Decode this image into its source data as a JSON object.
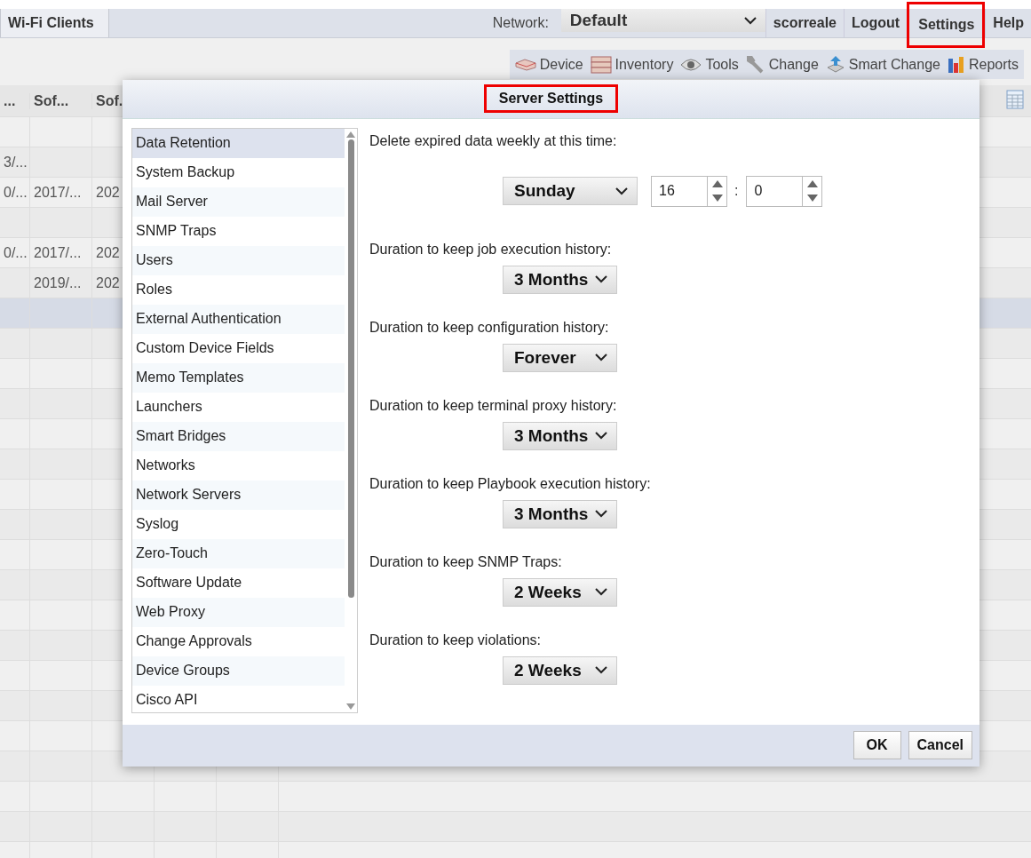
{
  "header": {
    "tabs": [
      {
        "label": "Wi-Fi Clients",
        "selected": true
      }
    ],
    "network": {
      "label": "Network:",
      "value": "Default"
    },
    "nav": [
      {
        "label": "scorreale",
        "highlighted": false
      },
      {
        "label": "Logout",
        "highlighted": false
      },
      {
        "label": "Settings",
        "highlighted": true
      },
      {
        "label": "Help",
        "highlighted": false
      }
    ]
  },
  "toolbar": [
    {
      "label": "Device",
      "kind": "device"
    },
    {
      "label": "Inventory",
      "kind": "inventory"
    },
    {
      "label": "Tools",
      "kind": "tools"
    },
    {
      "label": "Change",
      "kind": "change"
    },
    {
      "label": "Smart Change",
      "kind": "smart"
    },
    {
      "label": "Reports",
      "kind": "reports"
    }
  ],
  "table": {
    "columns": [
      "...",
      "Sof...",
      "Sof."
    ],
    "rows": [
      {
        "cells": [
          null,
          null,
          null
        ],
        "selected": false
      },
      {
        "cells": [
          "3/...",
          null,
          null
        ],
        "selected": false
      },
      {
        "cells": [
          "0/...",
          "2017/...",
          "202"
        ],
        "selected": false
      },
      {
        "cells": [
          null,
          null,
          null
        ],
        "selected": false
      },
      {
        "cells": [
          "0/...",
          "2017/...",
          "202"
        ],
        "selected": false
      },
      {
        "cells": [
          null,
          "2019/...",
          "202"
        ],
        "selected": false
      },
      {
        "cells": [
          null,
          null,
          null
        ],
        "selected": true
      }
    ]
  },
  "dialog": {
    "title": "Server Settings",
    "title_highlighted": true,
    "sections": [
      {
        "label": "Data Retention",
        "selected": true
      },
      {
        "label": "System Backup",
        "selected": false
      },
      {
        "label": "Mail Server",
        "selected": false
      },
      {
        "label": "SNMP Traps",
        "selected": false
      },
      {
        "label": "Users",
        "selected": false
      },
      {
        "label": "Roles",
        "selected": false
      },
      {
        "label": "External Authentication",
        "selected": false
      },
      {
        "label": "Custom Device Fields",
        "selected": false
      },
      {
        "label": "Memo Templates",
        "selected": false
      },
      {
        "label": "Launchers",
        "selected": false
      },
      {
        "label": "Smart Bridges",
        "selected": false
      },
      {
        "label": "Networks",
        "selected": false
      },
      {
        "label": "Network Servers",
        "selected": false
      },
      {
        "label": "Syslog",
        "selected": false
      },
      {
        "label": "Zero-Touch",
        "selected": false
      },
      {
        "label": "Software Update",
        "selected": false
      },
      {
        "label": "Web Proxy",
        "selected": false
      },
      {
        "label": "Change Approvals",
        "selected": false
      },
      {
        "label": "Device Groups",
        "selected": false
      },
      {
        "label": "Cisco API",
        "selected": false
      }
    ],
    "schedule": {
      "label": "Delete expired data weekly at this time:",
      "day": "Sunday",
      "hour": "16",
      "separator": ":",
      "minute": "0"
    },
    "durations": [
      {
        "label": "Duration to keep job execution history:",
        "value": "3 Months"
      },
      {
        "label": "Duration to keep configuration history:",
        "value": "Forever"
      },
      {
        "label": "Duration to keep terminal proxy history:",
        "value": "3 Months"
      },
      {
        "label": "Duration to keep Playbook execution history:",
        "value": "3 Months"
      },
      {
        "label": "Duration to keep SNMP Traps:",
        "value": "2 Weeks"
      },
      {
        "label": "Duration to keep violations:",
        "value": "2 Weeks"
      }
    ],
    "buttons": [
      "OK",
      "Cancel"
    ]
  }
}
